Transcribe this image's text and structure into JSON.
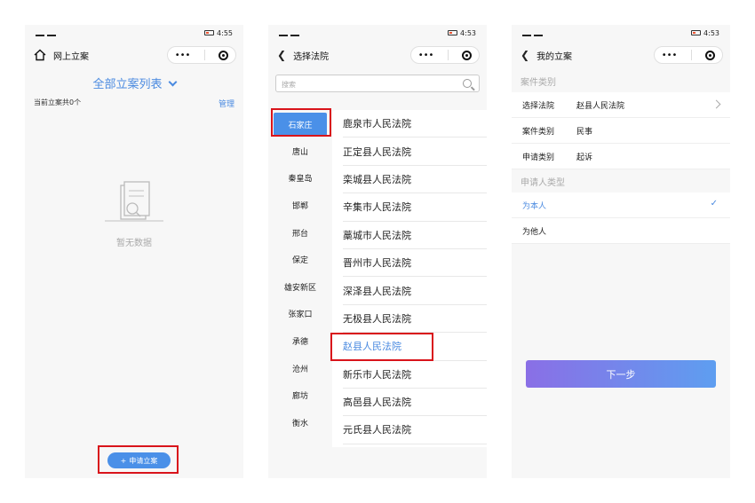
{
  "panel1": {
    "status_time": "4:55",
    "nav_title": "网上立案",
    "list_title": "全部立案列表",
    "count_text": "当前立案共0个",
    "manage_label": "管理",
    "empty_text": "暂无数据",
    "apply_label": "申请立案",
    "apply_plus": "+"
  },
  "panel2": {
    "status_time": "4:53",
    "nav_title": "选择法院",
    "search_placeholder": "搜索",
    "cities": [
      "石家庄",
      "唐山",
      "秦皇岛",
      "邯郸",
      "邢台",
      "保定",
      "雄安新区",
      "张家口",
      "承德",
      "沧州",
      "廊坊",
      "衡水"
    ],
    "selected_city": "石家庄",
    "courts": [
      "鹿泉市人民法院",
      "正定县人民法院",
      "栾城县人民法院",
      "辛集市人民法院",
      "藁城市人民法院",
      "晋州市人民法院",
      "深泽县人民法院",
      "无极县人民法院",
      "赵县人民法院",
      "新乐市人民法院",
      "高邑县人民法院",
      "元氏县人民法院"
    ],
    "selected_court": "赵县人民法院"
  },
  "panel3": {
    "status_time": "4:53",
    "nav_title": "我的立案",
    "section_case": "案件类别",
    "rows": [
      {
        "label": "选择法院",
        "value": "赵县人民法院"
      },
      {
        "label": "案件类别",
        "value": "民事"
      },
      {
        "label": "申请类别",
        "value": "起诉"
      }
    ],
    "section_applicant": "申请人类型",
    "option_self": "为本人",
    "option_other": "为他人",
    "next_label": "下一步"
  },
  "capsule": {
    "dots": "•••"
  },
  "colors": {
    "accent": "#4a8ae0",
    "highlight": "#d9141b"
  }
}
